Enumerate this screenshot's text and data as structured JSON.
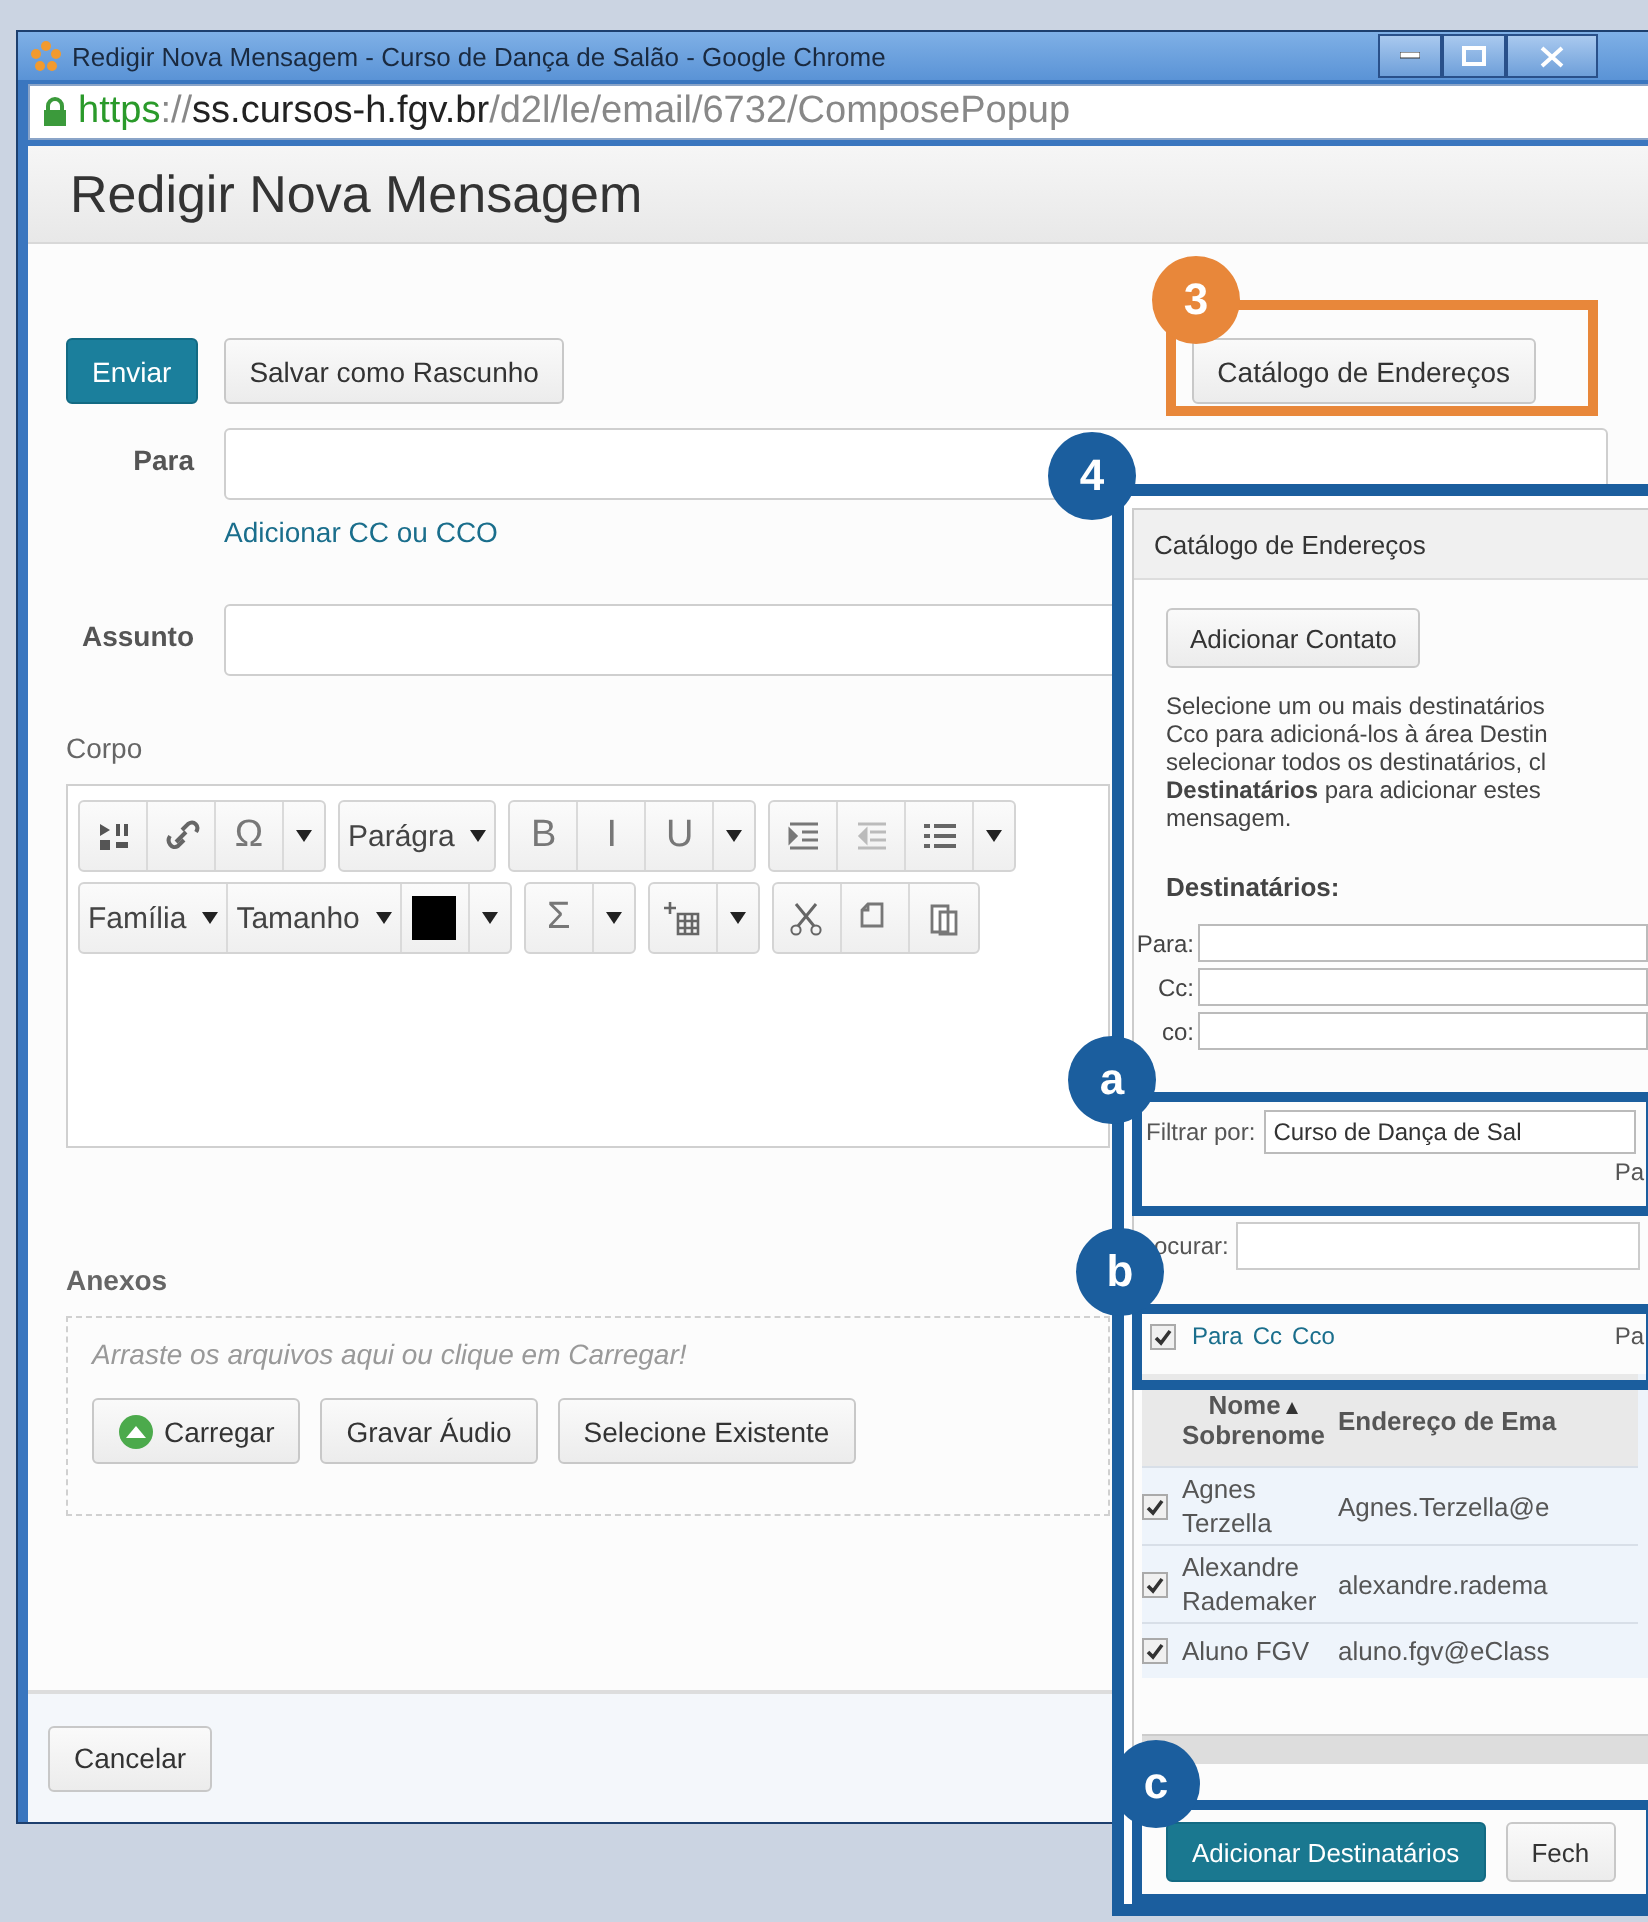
{
  "window": {
    "title": "Redigir Nova Mensagem - Curso de Dança de Salão - Google Chrome"
  },
  "url": {
    "scheme": "https",
    "separator": "://",
    "host": "ss.cursos-h.fgv.br",
    "path": "/d2l/le/email/6732/ComposePopup"
  },
  "page_title": "Redigir Nova Mensagem",
  "actions": {
    "send": "Enviar",
    "save_draft": "Salvar como Rascunho",
    "address_book": "Catálogo de Endereços"
  },
  "fields": [
    {
      "label": "Para"
    },
    {
      "label": "Assunto"
    }
  ],
  "cc_link": "Adicionar CC ou CCO",
  "body": {
    "label": "Corpo",
    "toolbar_rows": [
      [
        [
          {
            "kind": "media"
          },
          {
            "kind": "link"
          },
          {
            "kind": "glyph",
            "text": "Ω"
          },
          {
            "kind": "caret"
          }
        ],
        [
          {
            "kind": "select",
            "text": "Parágra"
          }
        ],
        [
          {
            "kind": "glyph",
            "text": "B"
          },
          {
            "kind": "glyph",
            "text": "I"
          },
          {
            "kind": "glyph",
            "text": "U"
          },
          {
            "kind": "caret"
          }
        ],
        [
          {
            "kind": "indent"
          },
          {
            "kind": "outdent"
          },
          {
            "kind": "list"
          },
          {
            "kind": "caret"
          }
        ]
      ],
      [
        [
          {
            "kind": "select",
            "text": "Família"
          },
          {
            "kind": "select",
            "text": "Tamanho"
          },
          {
            "kind": "swatch",
            "color": "#000000"
          },
          {
            "kind": "caret"
          }
        ],
        [
          {
            "kind": "glyph",
            "text": "Σ"
          },
          {
            "kind": "caret"
          }
        ],
        [
          {
            "kind": "table"
          },
          {
            "kind": "caret"
          }
        ],
        [
          {
            "kind": "cut"
          },
          {
            "kind": "copy"
          },
          {
            "kind": "paste"
          }
        ]
      ]
    ]
  },
  "attachments": {
    "label": "Anexos",
    "hint": "Arraste os arquivos aqui ou clique em Carregar!",
    "buttons": [
      {
        "kind": "upload",
        "label": "Carregar"
      },
      {
        "kind": "plain",
        "label": "Gravar Áudio"
      },
      {
        "kind": "plain",
        "label": "Selecione Existente"
      }
    ]
  },
  "cancel": "Cancelar",
  "address_book": {
    "title": "Catálogo de Endereços",
    "add_contact": "Adicionar Contato",
    "instructions": "Selecione um ou mais destinatários\nCco para adicioná-los à área Destin\nselecionar todos os destinatários, cl\n**Destinatários** para adicionar estes\nmensagem.",
    "recipients_label": "Destinatários:",
    "recipient_fields": [
      {
        "label": "Para:"
      },
      {
        "label": "Cc:"
      },
      {
        "label": "co:"
      }
    ],
    "filter": {
      "label": "Filtrar por:",
      "value": "Curso de Dança de Sal"
    },
    "filter_side": "Pa",
    "search": {
      "label": "ocurar:"
    },
    "select_all": {
      "checked": true,
      "links": [
        "Para",
        "Cc",
        "Cco"
      ],
      "side": "Pa"
    },
    "columns": [
      {
        "label": "Nome",
        "sub": "Sobrenome",
        "sort_ascending": true
      },
      {
        "label": "Endereço de Ema"
      }
    ],
    "rows": [
      {
        "checked": true,
        "name": "Agnes Terzella",
        "email": "Agnes.Terzella@e"
      },
      {
        "checked": true,
        "name": "Alexandre Rademaker",
        "email": "alexandre.radema"
      },
      {
        "checked": true,
        "name": "Aluno FGV",
        "email": "aluno.fgv@eClass"
      }
    ],
    "buttons": [
      {
        "kind": "primary",
        "label": "Adicionar Destinatários"
      },
      {
        "kind": "plain",
        "label": "Fech"
      }
    ]
  },
  "callouts": [
    {
      "label": "3",
      "color": "#e8873a"
    },
    {
      "label": "4",
      "color": "#1b5e9e"
    },
    {
      "label": "a",
      "color": "#1b5e9e"
    },
    {
      "label": "b",
      "color": "#1b5e9e"
    },
    {
      "label": "c",
      "color": "#1b5e9e"
    }
  ]
}
